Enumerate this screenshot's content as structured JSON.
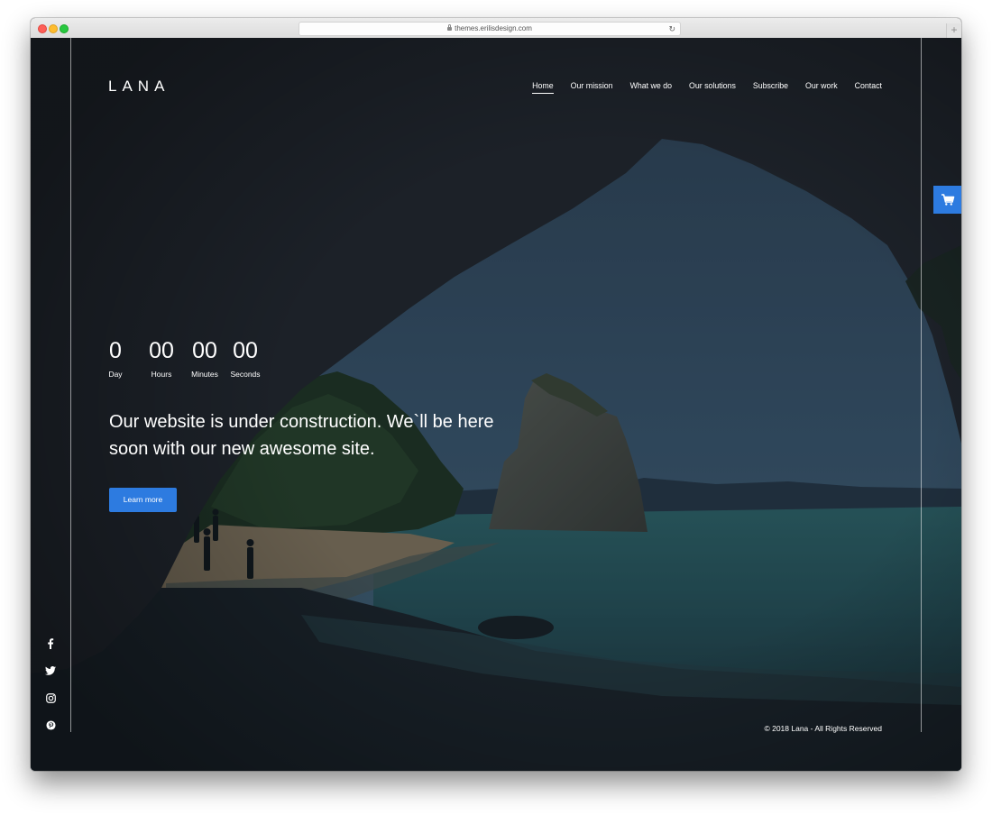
{
  "browser": {
    "url": "themes.erilisdesign.com"
  },
  "site": {
    "logo": "LANA"
  },
  "nav": {
    "items": [
      "Home",
      "Our mission",
      "What we do",
      "Our solutions",
      "Subscribe",
      "Our work",
      "Contact"
    ],
    "active": "Home"
  },
  "countdown": [
    {
      "value": "0",
      "label": "Day"
    },
    {
      "value": "00",
      "label": "Hours"
    },
    {
      "value": "00",
      "label": "Minutes"
    },
    {
      "value": "00",
      "label": "Seconds"
    }
  ],
  "hero": {
    "headline": "Our website is under construction. We`ll be here soon with our new awesome site.",
    "button_label": "Learn more"
  },
  "social": [
    "facebook-icon",
    "twitter-icon",
    "instagram-icon",
    "pinterest-icon"
  ],
  "cart": {
    "icon": "cart-icon"
  },
  "footer": {
    "copyright": "© 2018 Lana - All Rights Reserved"
  },
  "colors": {
    "accent": "#2d7be0",
    "background": "#1f252b"
  }
}
